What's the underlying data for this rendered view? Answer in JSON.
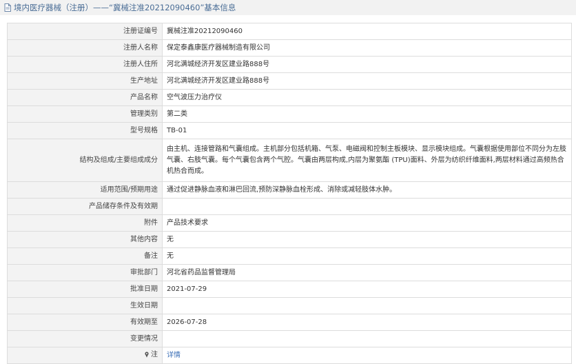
{
  "header": {
    "icon": "document-icon",
    "title": "境内医疗器械（注册）——“冀械注准20212090460”基本信息"
  },
  "rows": {
    "reg_no": {
      "label": "注册证编号",
      "value": "冀械注准20212090460"
    },
    "registrant": {
      "label": "注册人名称",
      "value": "保定泰鑫康医疗器械制造有限公司"
    },
    "registrant_address": {
      "label": "注册人住所",
      "value": "河北满城经济开发区建业路888号"
    },
    "production_address": {
      "label": "生产地址",
      "value": "河北满城经济开发区建业路888号"
    },
    "product_name": {
      "label": "产品名称",
      "value": "空气波压力治疗仪"
    },
    "category": {
      "label": "管理类别",
      "value": "第二类"
    },
    "model": {
      "label": "型号规格",
      "value": "TB-01"
    },
    "composition": {
      "label": "结构及组成/主要组成成分",
      "value": "由主机、连接管路和气囊组成。主机部分包括机箱、气泵、电磁阀和控制主板模块、显示模块组成。气囊根据使用部位不同分为左肢气囊、右肢气囊。每个气囊包含两个气腔。气囊由两层构成,内层为聚氨酯 (TPU)面料、外层为纺织纤维面料,两层材料通过高频热合机热合而成。"
    },
    "intended_use": {
      "label": "适用范围/预期用途",
      "value": "通过促进静脉血液和淋巴回流,预防深静脉血栓形成、消除或减轻肢体水肿。"
    },
    "storage": {
      "label": "产品储存条件及有效期",
      "value": ""
    },
    "attachment": {
      "label": "附件",
      "value": "产品技术要求"
    },
    "other": {
      "label": "其他内容",
      "value": "无"
    },
    "remark": {
      "label": "备注",
      "value": "无"
    },
    "approval_dept": {
      "label": "审批部门",
      "value": "河北省药品监督管理局"
    },
    "approval_date": {
      "label": "批准日期",
      "value": "2021-07-29"
    },
    "effective_date": {
      "label": "生效日期",
      "value": ""
    },
    "expiry_date": {
      "label": "有效期至",
      "value": "2026-07-28"
    },
    "change_info": {
      "label": "变更情况",
      "value": ""
    },
    "note": {
      "label": "注",
      "icon": "pin-icon",
      "link": "详情"
    }
  },
  "colors": {
    "header_bg": "#f2f2f2",
    "header_text": "#4a6d96",
    "label_bg": "#f3f3f3",
    "border": "#dcdcdc",
    "link": "#3b6fb6"
  }
}
